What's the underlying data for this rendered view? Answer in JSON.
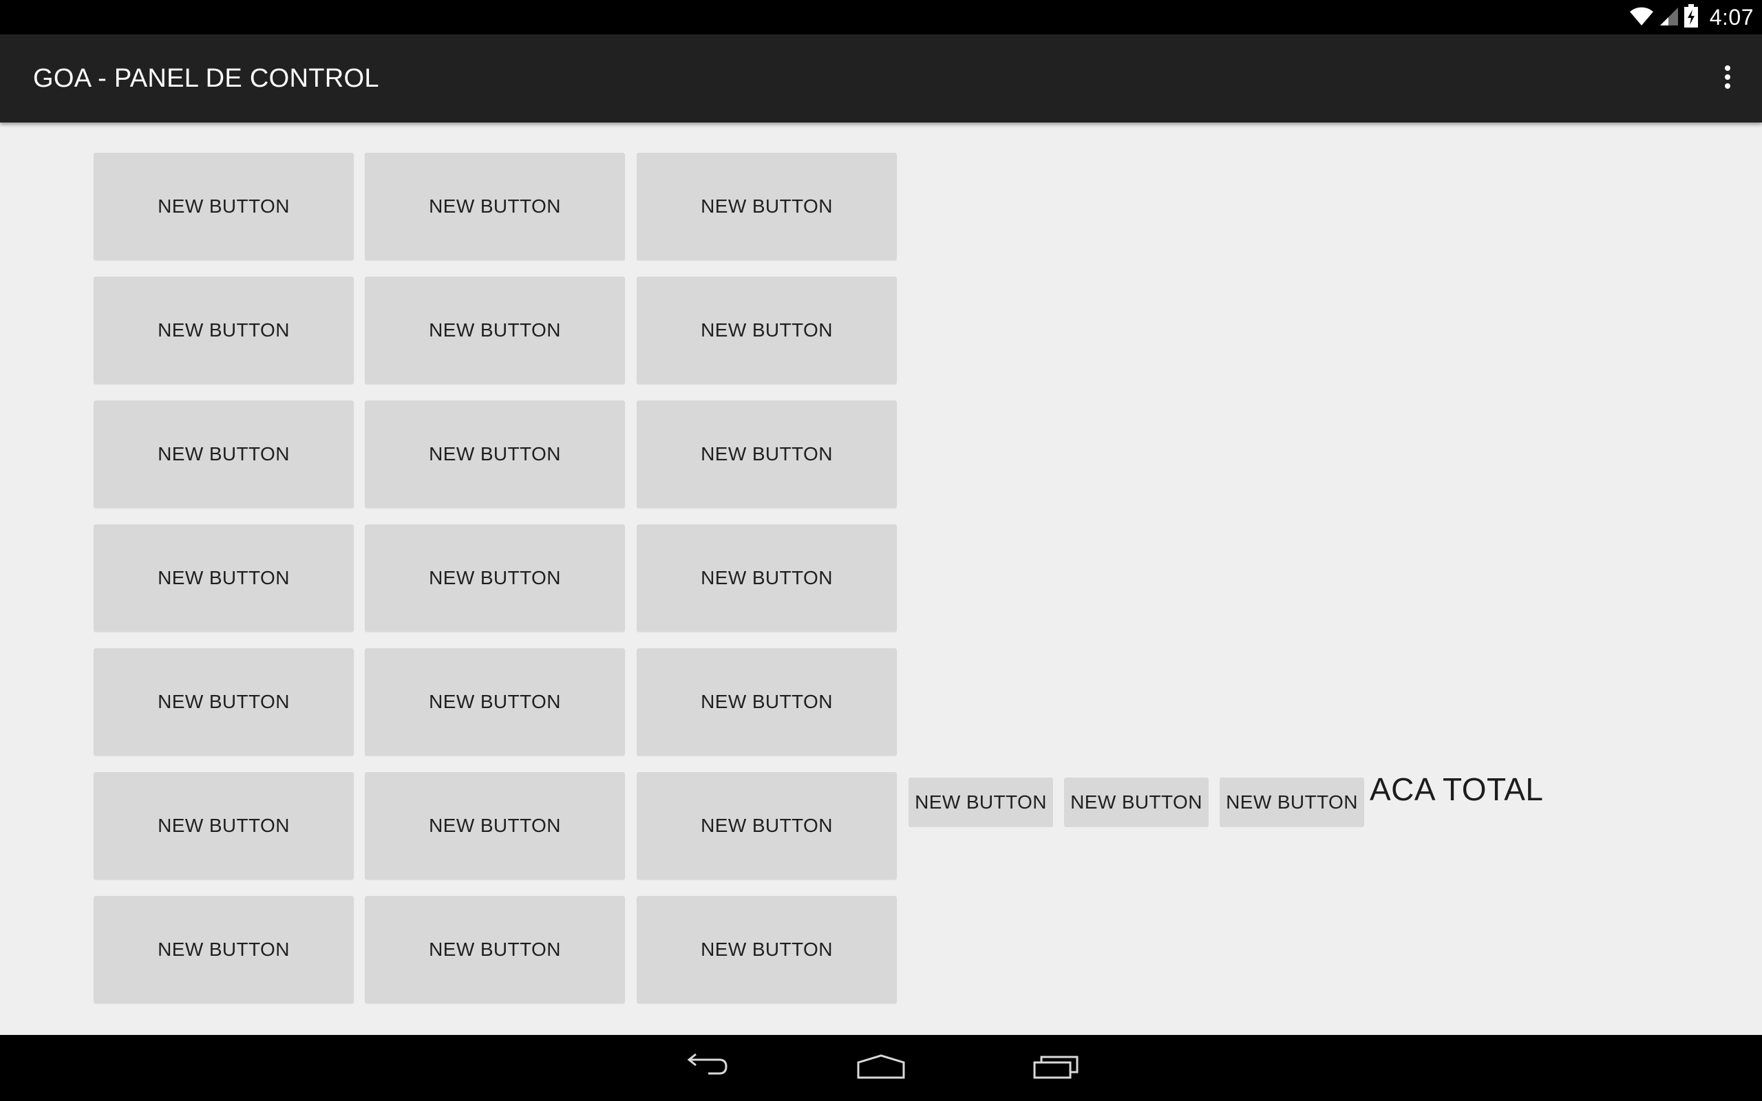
{
  "status_bar": {
    "time": "4:07",
    "icons": [
      "wifi-icon",
      "signal-icon",
      "battery-charging-icon"
    ]
  },
  "action_bar": {
    "title": "GOA - PANEL DE CONTROL",
    "overflow_icon": "overflow-menu-icon"
  },
  "grid": {
    "rows": [
      [
        "NEW BUTTON",
        "NEW BUTTON",
        "NEW BUTTON"
      ],
      [
        "NEW BUTTON",
        "NEW BUTTON",
        "NEW BUTTON"
      ],
      [
        "NEW BUTTON",
        "NEW BUTTON",
        "NEW BUTTON"
      ],
      [
        "NEW BUTTON",
        "NEW BUTTON",
        "NEW BUTTON"
      ],
      [
        "NEW BUTTON",
        "NEW BUTTON",
        "NEW BUTTON"
      ],
      [
        "NEW BUTTON",
        "NEW BUTTON",
        "NEW BUTTON"
      ],
      [
        "NEW BUTTON",
        "NEW BUTTON",
        "NEW BUTTON"
      ]
    ]
  },
  "side_buttons": [
    "NEW BUTTON",
    "NEW BUTTON",
    "NEW BUTTON"
  ],
  "total_label": "ACA TOTAL",
  "nav_bar": {
    "icons": [
      "back-icon",
      "home-icon",
      "recents-icon"
    ]
  },
  "colors": {
    "status_bar": "#000000",
    "action_bar": "#212121",
    "background": "#efefef",
    "button": "#d7d8d7",
    "button_text": "#1f1f1f"
  }
}
